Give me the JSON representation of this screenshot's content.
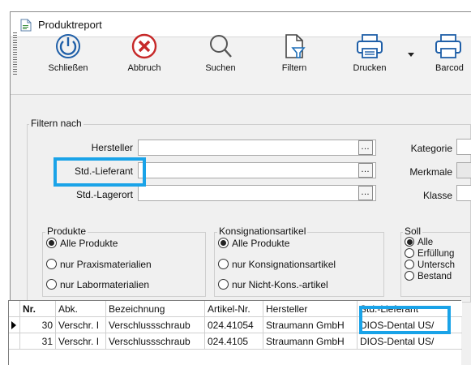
{
  "window": {
    "title": "Produktreport"
  },
  "toolbar": {
    "buttons": [
      {
        "label": "Schließen",
        "icon": "power-icon"
      },
      {
        "label": "Abbruch",
        "icon": "cancel-icon"
      },
      {
        "label": "Suchen",
        "icon": "search-icon"
      },
      {
        "label": "Filtern",
        "icon": "filter-document-icon"
      },
      {
        "label": "Drucken",
        "icon": "printer-icon"
      },
      {
        "label": "Barcod",
        "icon": "printer-icon"
      }
    ]
  },
  "filter": {
    "legend": "Filtern nach",
    "fields": [
      {
        "label": "Hersteller",
        "value": ""
      },
      {
        "label": "Std.-Lieferant",
        "value": ""
      },
      {
        "label": "Std.-Lagerort",
        "value": ""
      }
    ],
    "right_labels": [
      "Kategorie",
      "Merkmale",
      "Klasse"
    ],
    "ellipsis": "…"
  },
  "groups": {
    "produkte": {
      "legend": "Produkte",
      "options": [
        "Alle Produkte",
        "nur Praxismaterialien",
        "nur Labormaterialien"
      ],
      "selected": 0
    },
    "konsignation": {
      "legend": "Konsignationsartikel",
      "options": [
        "Alle Produkte",
        "nur Konsignationsartikel",
        "nur Nicht-Kons.-artikel"
      ],
      "selected": 0
    },
    "soll": {
      "legend": "Soll",
      "options": [
        "Alle",
        "Erfüllung",
        "Untersch",
        "Bestand"
      ],
      "selected": 0
    }
  },
  "table": {
    "columns": [
      "Nr.",
      "Abk.",
      "Bezeichnung",
      "Artikel-Nr.",
      "Hersteller",
      "Std.-Lieferant"
    ],
    "rows": [
      {
        "nr": "30",
        "abk": "Verschr. I",
        "bez": "Verschlussschraub",
        "art": "024.41054",
        "herst": "Straumann GmbH",
        "lief": "DIOS-Dental US/"
      },
      {
        "nr": "31",
        "abk": "Verschr. I",
        "bez": "Verschlussschraub",
        "art": "024.4105",
        "herst": "Straumann GmbH",
        "lief": "DIOS-Dental US/"
      }
    ]
  },
  "colors": {
    "highlight": "#1aa3e8"
  }
}
